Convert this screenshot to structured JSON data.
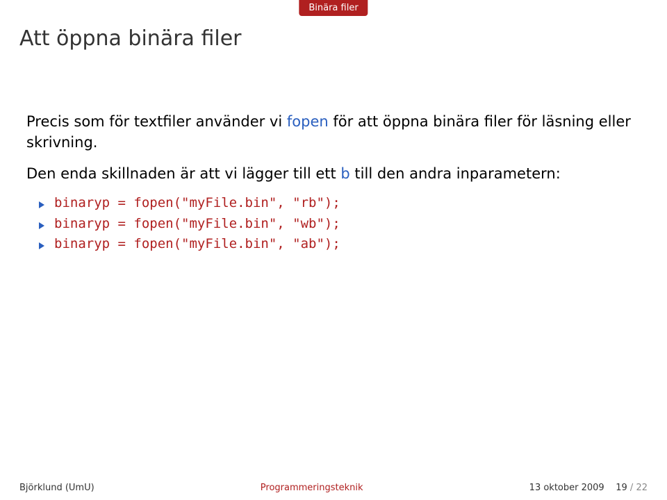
{
  "nav_tab": "Binära filer",
  "title": "Att öppna binära filer",
  "para1": {
    "pre": "Precis som för textfiler använder vi ",
    "fopen": "fopen",
    "post": " för att öppna binära filer för läsning eller skrivning."
  },
  "para2": {
    "pre": "Den enda skillnaden är att vi lägger till ett ",
    "b": "b",
    "post": " till den andra inparametern:"
  },
  "bullets": [
    "binaryp = fopen(\"myFile.bin\", \"rb\");",
    "binaryp = fopen(\"myFile.bin\", \"wb\");",
    "binaryp = fopen(\"myFile.bin\", \"ab\");"
  ],
  "footer": {
    "left": "Björklund (UmU)",
    "center": "Programmeringsteknik",
    "right_date": "13 oktober 2009",
    "right_page_cur": "19",
    "right_page_sep": " / ",
    "right_page_total": "22"
  }
}
